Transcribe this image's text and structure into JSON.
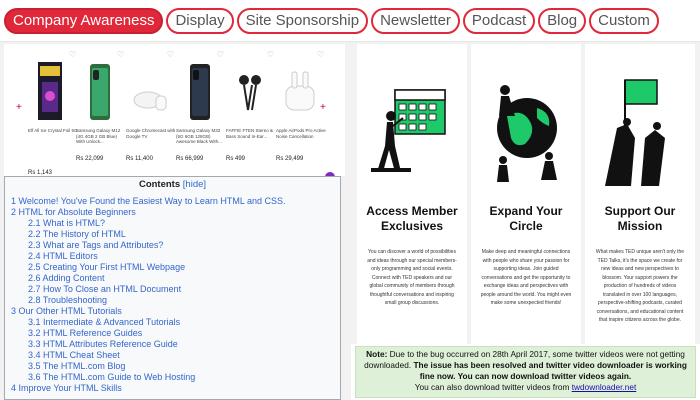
{
  "tabs": [
    {
      "label": "Company Awareness",
      "active": true
    },
    {
      "label": "Display",
      "active": false
    },
    {
      "label": "Site Sponsorship",
      "active": false
    },
    {
      "label": "Newsletter",
      "active": false
    },
    {
      "label": "Podcast",
      "active": false
    },
    {
      "label": "Blog",
      "active": false
    },
    {
      "label": "Custom",
      "active": false
    }
  ],
  "products": [
    {
      "name": "Elf All Ice Crystal Foil 5G",
      "price": "Rs 1,143",
      "icon": "book-icon"
    },
    {
      "name": "Samsung Galaxy M12 (4G 4GB 2 GB Blue) With Unlock...",
      "price": "Rs 22,099",
      "icon": "phone-icon"
    },
    {
      "name": "Google Chromecast with Google TV",
      "price": "Rs 11,400",
      "icon": "chromecast-icon"
    },
    {
      "name": "Samsung Galaxy M32 (5G 6GB 128GB) Awesome Black With...",
      "price": "Rs 66,999",
      "icon": "phone-icon"
    },
    {
      "name": "FAFFIE FTEN Stereo & Bass Sound In-Ear...",
      "price": "Rs 499",
      "icon": "earphones-icon"
    },
    {
      "name": "Apple AirPods Pro Active Noise Cancellation",
      "price": "Rs 29,499",
      "icon": "airpods-icon"
    }
  ],
  "toc": {
    "title": "Contents",
    "hide_label": "[hide]",
    "items": [
      {
        "label": "1 Welcome! You've Found the Easiest Way to Learn HTML and CSS.",
        "level": 1
      },
      {
        "label": "2 HTML for Absolute Beginners",
        "level": 1
      },
      {
        "label": "2.1 What is HTML?",
        "level": 2
      },
      {
        "label": "2.2 The History of HTML",
        "level": 2
      },
      {
        "label": "2.3 What are Tags and Attributes?",
        "level": 2
      },
      {
        "label": "2.4 HTML Editors",
        "level": 2
      },
      {
        "label": "2.5 Creating Your First HTML Webpage",
        "level": 2
      },
      {
        "label": "2.6 Adding Content",
        "level": 2
      },
      {
        "label": "2.7 How To Close an HTML Document",
        "level": 2
      },
      {
        "label": "2.8 Troubleshooting",
        "level": 2
      },
      {
        "label": "3 Our Other HTML Tutorials",
        "level": 1
      },
      {
        "label": "3.1 Intermediate & Advanced Tutorials",
        "level": 2
      },
      {
        "label": "3.2 HTML Reference Guides",
        "level": 2
      },
      {
        "label": "3.3 HTML Attributes Reference Guide",
        "level": 2
      },
      {
        "label": "3.4 HTML Cheat Sheet",
        "level": 2
      },
      {
        "label": "3.5 The HTML.com Blog",
        "level": 2
      },
      {
        "label": "3.6 The HTML.com Guide to Web Hosting",
        "level": 2
      },
      {
        "label": "4 Improve Your HTML Skills",
        "level": 1
      }
    ]
  },
  "features": [
    {
      "title": "Access Member Exclusives",
      "desc": "You can discover a world of possibilities and ideas through our special members-only programming and social events. Connect with TED speakers and our global community of members through thoughtful conversations and inspiring small group discussions.",
      "icon": "calendar-person-icon"
    },
    {
      "title": "Expand Your Circle",
      "desc": "Make deep and meaningful connections with people who share your passion for supporting ideas. Join guided conversations and get the opportunity to exchange ideas and perspectives with people around the world. You might even make some unexpected friends!",
      "icon": "globe-people-icon"
    },
    {
      "title": "Support Our Mission",
      "desc": "What makes TED unique aren't only the TED Talks, it's the space we create for new ideas and new perspectives to blossom. Your support powers the production of hundreds of videos translated in over 100 languages, perspective-shifting podcasts, curated conversations, and educational content that inspire citizens across the globe.",
      "icon": "hands-flag-icon"
    }
  ],
  "note": {
    "label": "Note:",
    "text1": " Due to the bug occurred on 28th April 2017, some twitter videos were not getting downloaded.",
    "bold": "The issue has been resolved and twitter video downloader is working fine now. You can now download twitter videos again.",
    "text2": "You can also download twitter videos from ",
    "link": "twdownloader.net"
  },
  "colors": {
    "accent": "#e0283a",
    "link": "#3366cc",
    "note_bg": "#dff0d8",
    "illus_green": "#1ec96a"
  }
}
